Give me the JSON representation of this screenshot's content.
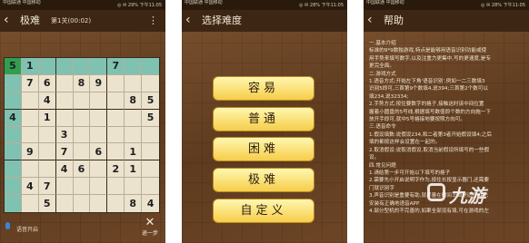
{
  "screens": [
    {
      "status": {
        "carrier": "中国联通\n中国移动",
        "right": "◎ ✉ 29% 下午11:05"
      },
      "title": "极难",
      "level": "第1关(00:02)",
      "board": [
        [
          "5",
          "1",
          "",
          "",
          "",
          "",
          "7",
          "",
          ""
        ],
        [
          "",
          "7",
          "6",
          "",
          "8",
          "9",
          "",
          "",
          ""
        ],
        [
          "",
          "",
          "4",
          "",
          "",
          "",
          "",
          "8",
          "5"
        ],
        [
          "4",
          "",
          "1",
          "",
          "",
          "",
          "",
          "",
          "5"
        ],
        [
          "",
          "",
          "",
          "3",
          "",
          "",
          "",
          "",
          ""
        ],
        [
          "",
          "9",
          "",
          "7",
          "",
          "6",
          "",
          "1",
          ""
        ],
        [
          "",
          "",
          "",
          "4",
          "6",
          "",
          "2",
          "1",
          ""
        ],
        [
          "",
          "4",
          "7",
          "",
          "",
          "",
          "",
          "",
          ""
        ],
        [
          "",
          "",
          "5",
          "",
          "",
          "",
          "",
          "8",
          "4"
        ]
      ],
      "voice_label": "语音开启",
      "undo_label": "退一步"
    },
    {
      "status": {
        "carrier": "中国联通\n中国移动",
        "right": "◎ ✉ 28% 下午11:05"
      },
      "title": "选择难度",
      "buttons": [
        "容易",
        "普通",
        "困难",
        "极难",
        "自定义"
      ]
    },
    {
      "status": {
        "carrier": "中国联通\n中国移动",
        "right": "◎ ✉ 28% 下午11:05"
      },
      "title": "帮助",
      "help_lines": [
        "一.基本介绍",
        "  标准的9*9数独游戏,特点是能够用语音识别功能或使",
        "用手势来填写数字,以及注重力更集中,写的更速度,是专",
        "更完全面。",
        "二.游戏方式",
        "  1.语音方式:开始左下角'语音识别',例如一二三数填3",
        "识别5即可,三首第9个数填4,说394;三首第2个数可以",
        "填234,说32334;",
        "  2.手势方式:按住要数字的格子,接触这时该中间位置",
        "握着小圆盘的5号线,根据填写数值即个数的方向拖一下",
        "放开手即可,就中5号格接地要按照方向可。",
        "三.语音命令",
        "  1.假设填数:说假设234,和二者第3者开始假设填4;之后",
        "填的都按这样会设置在一起的。",
        "  2.取消假设:说取消假设,取消当前假设所填写的一些假",
        "设。",
        "四.常见问题",
        "  1.请给第一步可开始以下填写的格子",
        "  2.需要先小开启说明字作为,按住长按显示器门,还需要",
        "门就识别字",
        "  3.声音识别是重要有助,就尽量在时间上面更适正APP;",
        "安装有正确地语音APP",
        "  4.部分型机的不完善的,如果全部没有填,可在游戏的左"
      ],
      "watermark": "九游"
    }
  ]
}
